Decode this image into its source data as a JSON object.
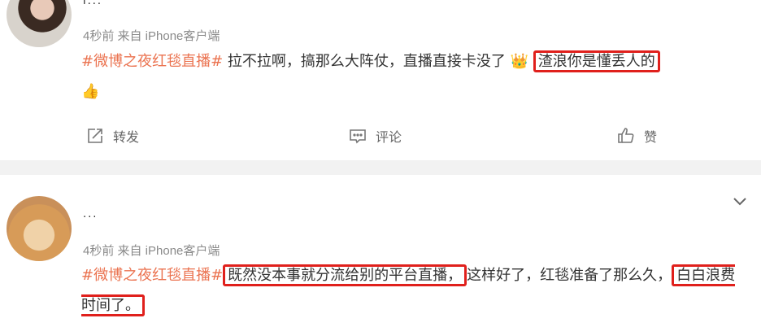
{
  "posts": [
    {
      "username": "l...",
      "meta": "4秒前 来自 iPhone客户端",
      "hashtag": "#微博之夜红毯直播#",
      "text_plain": " 拉不拉啊，搞那么大阵仗，直播直接卡没了",
      "emoji_1": "👑",
      "highlight": "渣浪你是懂丢人的",
      "emoji_2": "👍",
      "actions": {
        "repost": "转发",
        "comment": "评论",
        "like": "赞"
      }
    },
    {
      "username": "...",
      "meta": "4秒前 来自 iPhone客户端",
      "hashtag": "#微博之夜红毯直播#",
      "highlight_1": "既然没本事就分流给别的平台直播，",
      "text_plain": "这样好了，红毯准备了那么久，",
      "highlight_2": "白白浪费时间了。"
    }
  ],
  "colors": {
    "hashtag": "#eb7350",
    "highlight_border": "#e0201c"
  },
  "icons": {
    "expand": "chevron-down-icon",
    "repost": "repost-icon",
    "comment": "comment-icon",
    "like": "thumbs-up-icon"
  }
}
